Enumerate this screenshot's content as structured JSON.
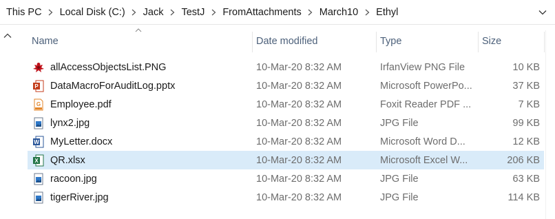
{
  "breadcrumb": [
    "This PC",
    "Local Disk (C:)",
    "Jack",
    "TestJ",
    "FromAttachments",
    "March10",
    "Ethyl"
  ],
  "columns": {
    "name": "Name",
    "date": "Date modified",
    "type": "Type",
    "size": "Size"
  },
  "files": [
    {
      "name": "allAccessObjectsList.PNG",
      "date": "10-Mar-20 8:32 AM",
      "type": "IrfanView PNG File",
      "size": "10 KB",
      "icon": "irfanview-icon"
    },
    {
      "name": "DataMacroForAuditLog.pptx",
      "date": "10-Mar-20 8:32 AM",
      "type": "Microsoft PowerPo...",
      "size": "37 KB",
      "icon": "powerpoint-icon"
    },
    {
      "name": "Employee.pdf",
      "date": "10-Mar-20 8:32 AM",
      "type": "Foxit Reader PDF ...",
      "size": "7 KB",
      "icon": "foxit-pdf-icon"
    },
    {
      "name": "lynx2.jpg",
      "date": "10-Mar-20 8:32 AM",
      "type": "JPG File",
      "size": "99 KB",
      "icon": "image-file-icon"
    },
    {
      "name": "MyLetter.docx",
      "date": "10-Mar-20 8:32 AM",
      "type": "Microsoft Word D...",
      "size": "12 KB",
      "icon": "word-icon"
    },
    {
      "name": "QR.xlsx",
      "date": "10-Mar-20 8:32 AM",
      "type": "Microsoft Excel W...",
      "size": "206 KB",
      "icon": "excel-icon",
      "selected": true
    },
    {
      "name": "racoon.jpg",
      "date": "10-Mar-20 8:32 AM",
      "type": "JPG File",
      "size": "63 KB",
      "icon": "image-file-icon"
    },
    {
      "name": "tigerRiver.jpg",
      "date": "10-Mar-20 8:32 AM",
      "type": "JPG File",
      "size": "114 KB",
      "icon": "image-file-icon"
    }
  ],
  "colors": {
    "selected_row": "#d9ebf9",
    "header_text": "#4c607a",
    "secondary_text": "#6d6d6d"
  }
}
